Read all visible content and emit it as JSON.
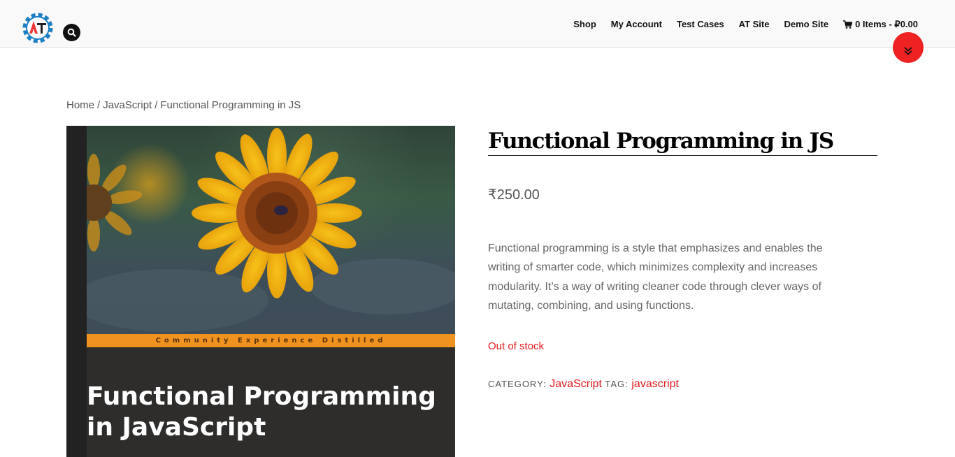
{
  "header": {
    "nav": [
      {
        "label": "Shop"
      },
      {
        "label": "My Account"
      },
      {
        "label": "Test Cases"
      },
      {
        "label": "AT Site"
      },
      {
        "label": "Demo Site"
      }
    ],
    "cart_label": "0 Items - ₽0.00"
  },
  "breadcrumb": {
    "home": "Home",
    "sep": "/",
    "category": "JavaScript",
    "current": "Functional Programming in JS"
  },
  "cover": {
    "banner": "Community Experience Distilled",
    "title": "Functional Programming\nin JavaScript"
  },
  "product": {
    "title": "Functional Programming in JS",
    "price": "₹250.00",
    "description": "Functional programming is a style that emphasizes and enables the writing of smarter code, which minimizes complexity and increases modularity. It’s a way of writing cleaner code through clever ways of mutating, combining, and using functions.",
    "stock": "Out of stock",
    "category_label": "CATEGORY:",
    "category": "JavaScript",
    "tag_label": "TAG:",
    "tag": "javascript"
  },
  "colors": {
    "accent": "#e01a1a",
    "header_bg": "#f9f9f9",
    "cover_orange": "#f0921f"
  }
}
